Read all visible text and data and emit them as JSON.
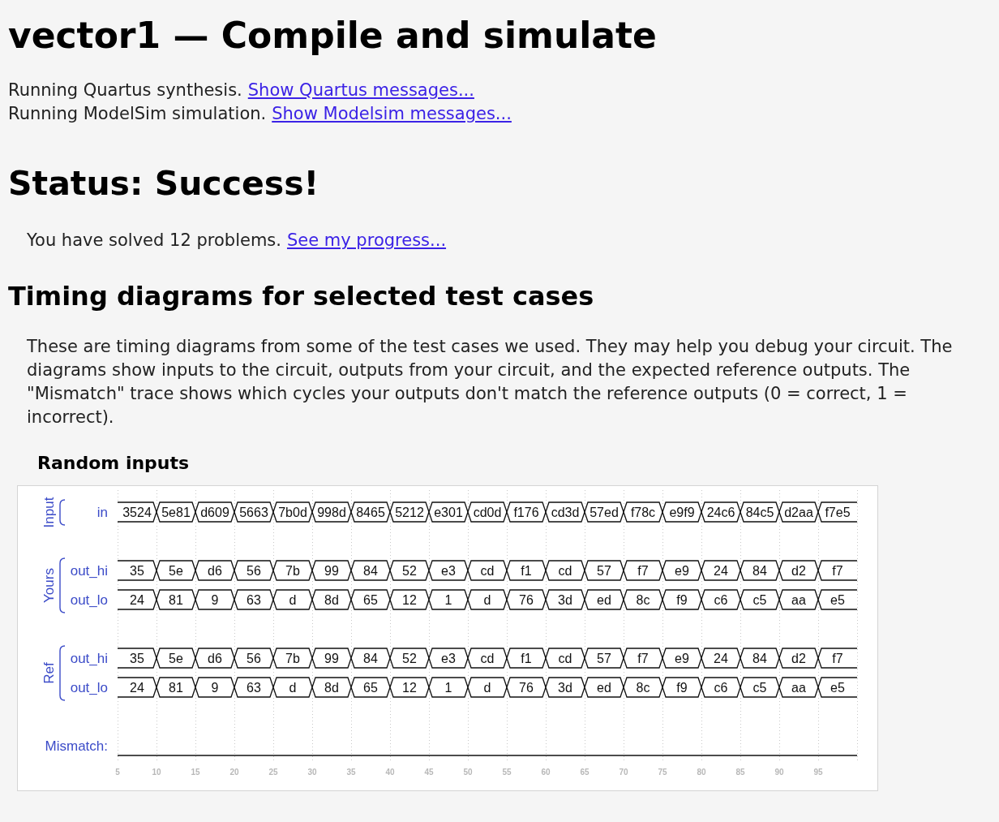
{
  "header": {
    "title": "vector1 — Compile and simulate"
  },
  "log": [
    {
      "text": "Running Quartus synthesis.",
      "link": "Show Quartus messages..."
    },
    {
      "text": "Running ModelSim simulation.",
      "link": "Show Modelsim messages..."
    }
  ],
  "status": {
    "title": "Status: Success!",
    "text": "You have solved 12 problems.",
    "link": "See my progress..."
  },
  "timing": {
    "title": "Timing diagrams for selected test cases",
    "intro": "These are timing diagrams from some of the test cases we used. They may help you debug your circuit. The diagrams show inputs to the circuit, outputs from your circuit, and the expected reference outputs. The \"Mismatch\" trace shows which cycles your outputs don't match the reference outputs (0 = correct, 1 = incorrect).",
    "diagrams": [
      {
        "title": "Random inputs",
        "groups": [
          {
            "label": "Input",
            "signals": [
              {
                "name": "in",
                "values": [
                  "3524",
                  "5e81",
                  "d609",
                  "5663",
                  "7b0d",
                  "998d",
                  "8465",
                  "5212",
                  "e301",
                  "cd0d",
                  "f176",
                  "cd3d",
                  "57ed",
                  "f78c",
                  "e9f9",
                  "24c6",
                  "84c5",
                  "d2aa",
                  "f7e5"
                ]
              }
            ]
          },
          {
            "label": "Yours",
            "signals": [
              {
                "name": "out_hi",
                "values": [
                  "35",
                  "5e",
                  "d6",
                  "56",
                  "7b",
                  "99",
                  "84",
                  "52",
                  "e3",
                  "cd",
                  "f1",
                  "cd",
                  "57",
                  "f7",
                  "e9",
                  "24",
                  "84",
                  "d2",
                  "f7"
                ]
              },
              {
                "name": "out_lo",
                "values": [
                  "24",
                  "81",
                  "9",
                  "63",
                  "d",
                  "8d",
                  "65",
                  "12",
                  "1",
                  "d",
                  "76",
                  "3d",
                  "ed",
                  "8c",
                  "f9",
                  "c6",
                  "c5",
                  "aa",
                  "e5"
                ]
              }
            ]
          },
          {
            "label": "Ref",
            "signals": [
              {
                "name": "out_hi",
                "values": [
                  "35",
                  "5e",
                  "d6",
                  "56",
                  "7b",
                  "99",
                  "84",
                  "52",
                  "e3",
                  "cd",
                  "f1",
                  "cd",
                  "57",
                  "f7",
                  "e9",
                  "24",
                  "84",
                  "d2",
                  "f7"
                ]
              },
              {
                "name": "out_lo",
                "values": [
                  "24",
                  "81",
                  "9",
                  "63",
                  "d",
                  "8d",
                  "65",
                  "12",
                  "1",
                  "d",
                  "76",
                  "3d",
                  "ed",
                  "8c",
                  "f9",
                  "c6",
                  "c5",
                  "aa",
                  "e5"
                ]
              }
            ]
          }
        ],
        "mismatch": {
          "label": "Mismatch:"
        },
        "time_ticks": [
          "5",
          "10",
          "15",
          "20",
          "25",
          "30",
          "35",
          "40",
          "45",
          "50",
          "55",
          "60",
          "65",
          "70",
          "75",
          "80",
          "85",
          "90",
          "95"
        ]
      }
    ]
  }
}
